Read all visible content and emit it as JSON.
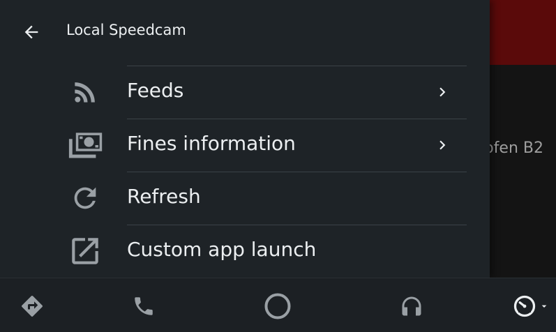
{
  "drawer": {
    "title": "Local Speedcam",
    "back_icon": "arrow-left-icon",
    "items": [
      {
        "label": "Feeds",
        "icon": "rss-icon",
        "has_submenu": true
      },
      {
        "label": "Fines information",
        "icon": "money-icon",
        "has_submenu": true
      },
      {
        "label": "Refresh",
        "icon": "refresh-icon",
        "has_submenu": false
      },
      {
        "label": "Custom app launch",
        "icon": "open-in-new-icon",
        "has_submenu": false
      }
    ]
  },
  "background": {
    "peek_text": "ofen B2",
    "header_color": "#5a0a0a"
  },
  "navbar": {
    "items": [
      {
        "icon": "navigation-icon"
      },
      {
        "icon": "phone-icon"
      },
      {
        "icon": "home-circle-icon"
      },
      {
        "icon": "headphones-icon"
      },
      {
        "icon": "speedometer-icon"
      }
    ]
  },
  "colors": {
    "drawer_bg": "#1e2327",
    "text": "#eceff1",
    "icon": "#9aa0a5",
    "divider": "#3b4247"
  }
}
